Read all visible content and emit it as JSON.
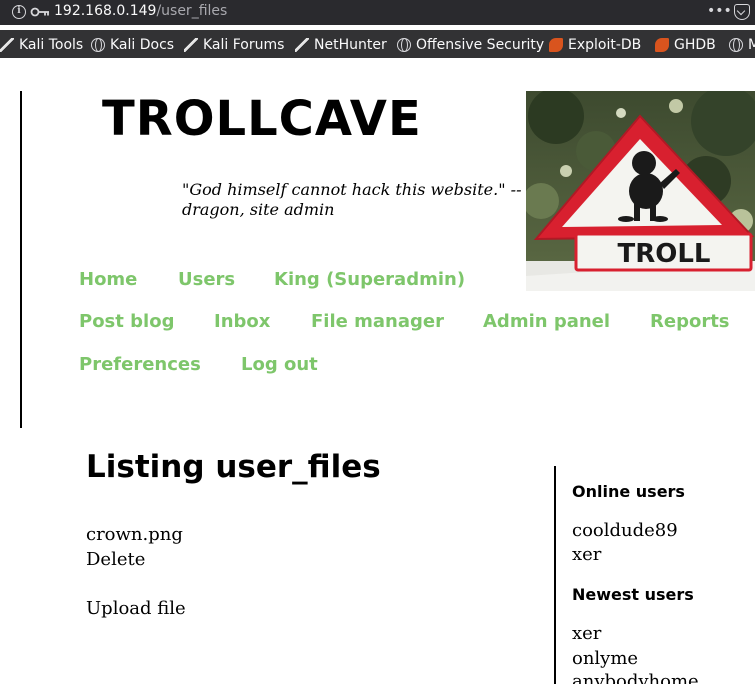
{
  "browser": {
    "url_host": "192.168.0.149",
    "url_path": "/user_files",
    "more_icon": "•••",
    "bookmarks": [
      {
        "label": "Kali Tools",
        "icon": "kali-icon"
      },
      {
        "label": "Kali Docs",
        "icon": "globe-icon"
      },
      {
        "label": "Kali Forums",
        "icon": "kali-icon"
      },
      {
        "label": "NetHunter",
        "icon": "kali-icon"
      },
      {
        "label": "Offensive Security",
        "icon": "globe-icon"
      },
      {
        "label": "Exploit-DB",
        "icon": "exploit-db-icon"
      },
      {
        "label": "GHDB",
        "icon": "exploit-db-icon"
      },
      {
        "label": "M",
        "icon": "globe-icon"
      }
    ]
  },
  "header": {
    "title": "TROLLCAVE",
    "tagline": "\"God himself cannot hack this website.\" -- dragon, site admin",
    "sign_text": "TROLL"
  },
  "nav": [
    "Home",
    "Users",
    "King (Superadmin)",
    "Post blog",
    "Inbox",
    "File manager",
    "Admin panel",
    "Reports",
    "Preferences",
    "Log out"
  ],
  "main": {
    "title": "Listing user_files",
    "file_name": "crown.png",
    "delete_label": "Delete",
    "upload_label": "Upload file"
  },
  "sidebar": {
    "online_heading": "Online users",
    "online_users": [
      "cooldude89",
      "xer"
    ],
    "newest_heading": "Newest users",
    "newest_users": [
      "xer",
      "onlyme",
      "anybodyhome"
    ]
  },
  "colors": {
    "nav_link": "#7ec66b",
    "chrome_bg": "#2a2a2e",
    "bookmarks_bg": "#323234"
  }
}
